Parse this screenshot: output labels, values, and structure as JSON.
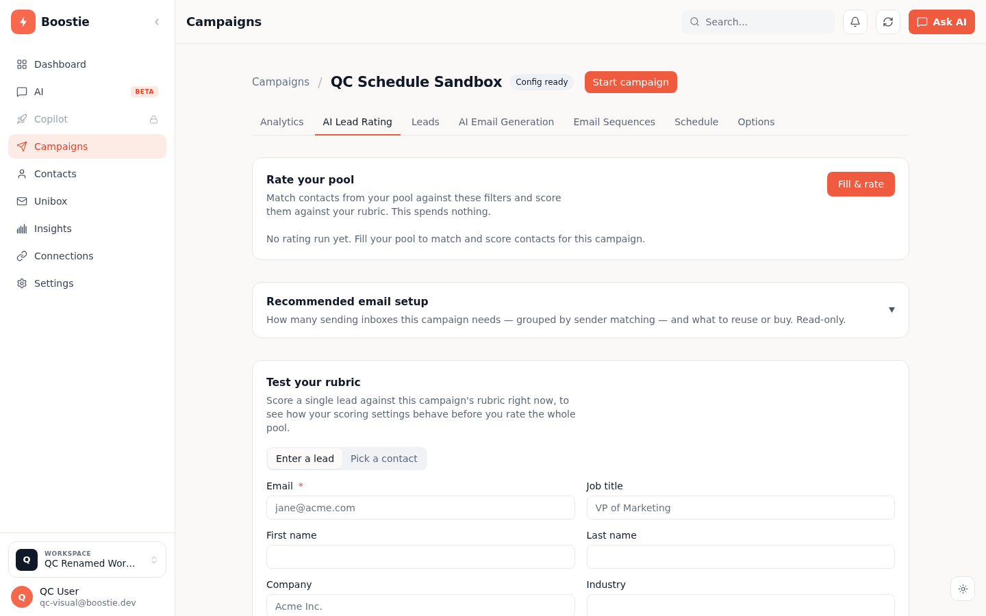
{
  "sidebar": {
    "brand": "Boostie",
    "nav": [
      {
        "label": "Dashboard",
        "selected": false,
        "locked": false
      },
      {
        "label": "AI",
        "selected": false,
        "locked": false,
        "badge": "BETA"
      },
      {
        "label": "Copilot",
        "selected": false,
        "locked": true
      },
      {
        "label": "Campaigns",
        "selected": true,
        "locked": false
      },
      {
        "label": "Contacts",
        "selected": false,
        "locked": false
      },
      {
        "label": "Unibox",
        "selected": false,
        "locked": false
      },
      {
        "label": "Insights",
        "selected": false,
        "locked": false
      },
      {
        "label": "Connections",
        "selected": false,
        "locked": false
      },
      {
        "label": "Settings",
        "selected": false,
        "locked": false
      }
    ],
    "workspace": {
      "initial": "Q",
      "caption": "WORKSPACE",
      "name": "QC Renamed Wor…"
    },
    "user": {
      "initial": "Q",
      "name": "QC User",
      "email": "qc-visual@boostie.dev"
    }
  },
  "header": {
    "title": "Campaigns",
    "search": {
      "placeholder": "Search..."
    },
    "ask_button": "Ask AI"
  },
  "breadcrumb": {
    "parent": "Campaigns",
    "separator": "/",
    "title": "QC Schedule Sandbox",
    "status": "Config ready",
    "action": "Start campaign"
  },
  "tabs": [
    {
      "label": "Analytics",
      "selected": false
    },
    {
      "label": "AI Lead Rating",
      "selected": true
    },
    {
      "label": "Leads",
      "selected": false
    },
    {
      "label": "AI Email Generation",
      "selected": false
    },
    {
      "label": "Email Sequences",
      "selected": false
    },
    {
      "label": "Schedule",
      "selected": false
    },
    {
      "label": "Options",
      "selected": false
    }
  ],
  "rate_pool": {
    "title": "Rate your pool",
    "description": "Match contacts from your pool against these filters and score them against your rubric. This spends nothing.",
    "note": "No rating run yet. Fill your pool to match and score contacts for this campaign.",
    "button": "Fill & rate"
  },
  "email_setup": {
    "title": "Recommended email setup",
    "description": "How many sending inboxes this campaign needs — grouped by sender matching — and what to reuse or buy. Read-only.",
    "expanded": false
  },
  "rubric_test": {
    "title": "Test your rubric",
    "description": "Score a single lead against this campaign's rubric right now, to see how your scoring settings behave before you rate the whole pool.",
    "modes": [
      {
        "label": "Enter a lead",
        "selected": true
      },
      {
        "label": "Pick a contact",
        "selected": false
      }
    ],
    "fields": [
      {
        "label": "Email",
        "required_mark": "*",
        "placeholder": "jane@acme.com"
      },
      {
        "label": "Job title",
        "placeholder": "VP of Marketing"
      },
      {
        "label": "First name"
      },
      {
        "label": "Last name"
      },
      {
        "label": "Company",
        "placeholder": "Acme Inc."
      },
      {
        "label": "Industry"
      }
    ]
  }
}
